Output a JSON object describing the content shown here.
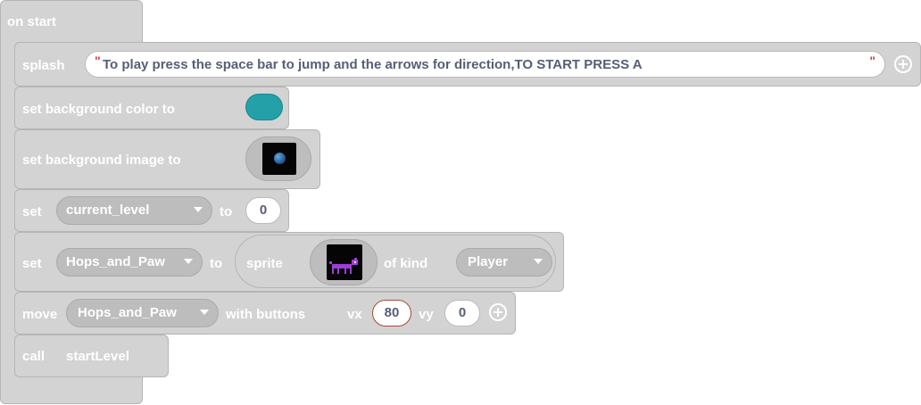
{
  "event": {
    "label": "on start"
  },
  "splash": {
    "label": "splash",
    "open_quote": "\"",
    "text": "To play press the space bar to jump and the arrows for direction,TO START PRESS A",
    "close_quote": "\"",
    "add_icon": "plus-circle-icon"
  },
  "bg_color": {
    "label": "set background color to",
    "color": "#23a0a8"
  },
  "bg_image": {
    "label": "set background image to",
    "thumbnail": "earth-in-space-image"
  },
  "set_level": {
    "set_label": "set",
    "variable": "current_level",
    "to_label": "to",
    "value": "0"
  },
  "set_sprite": {
    "set_label": "set",
    "variable": "Hops_and_Paw",
    "to_label": "to",
    "sprite_label": "sprite",
    "sprite_image": "purple-dog-sprite",
    "kind_label": "of kind",
    "kind": "Player"
  },
  "move": {
    "label": "move",
    "sprite": "Hops_and_Paw",
    "with_label": "with buttons",
    "vx_label": "vx",
    "vx": "80",
    "vy_label": "vy",
    "vy": "0",
    "add_icon": "plus-circle-icon"
  },
  "call": {
    "label": "call",
    "function": "startLevel"
  },
  "colors": {
    "block": "#d3d3d3",
    "input": "#bdbdbd",
    "text": "#575e75",
    "quote": "#d64545"
  }
}
